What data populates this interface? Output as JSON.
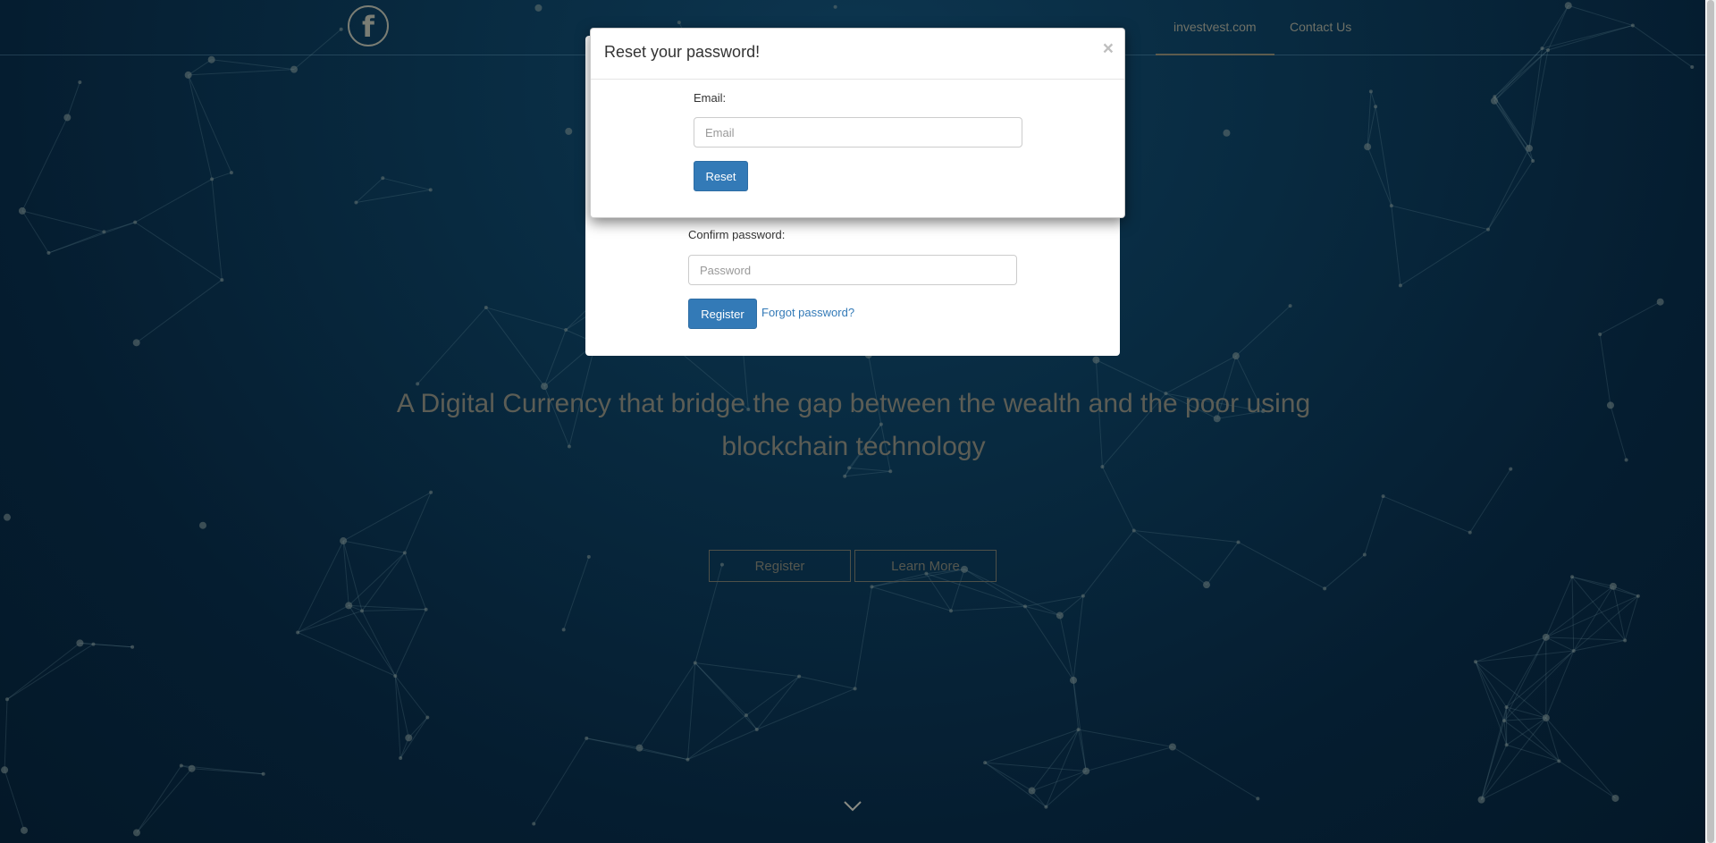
{
  "nav": {
    "logo_glyph": "f",
    "links": [
      "investvest.com",
      "Contact Us"
    ]
  },
  "hero": {
    "title": "A Digital Currency that bridge the gap between the wealth and the poor using blockchain technology",
    "register_label": "Register",
    "learn_more_label": "Learn More"
  },
  "register_modal": {
    "confirm_label": "Confirm password:",
    "confirm_placeholder": "Password",
    "register_label": "Register",
    "forgot_label": "Forgot password?"
  },
  "reset_modal": {
    "title": "Reset your password!",
    "close_glyph": "×",
    "email_label": "Email:",
    "email_placeholder": "Email",
    "reset_label": "Reset"
  },
  "icons": {
    "logo": "facebook-icon",
    "close": "close-icon",
    "scroll_down": "chevron-down-icon"
  },
  "colors": {
    "background": "#062538",
    "primary": "#337ab7",
    "muted_text": "#6f7167"
  }
}
